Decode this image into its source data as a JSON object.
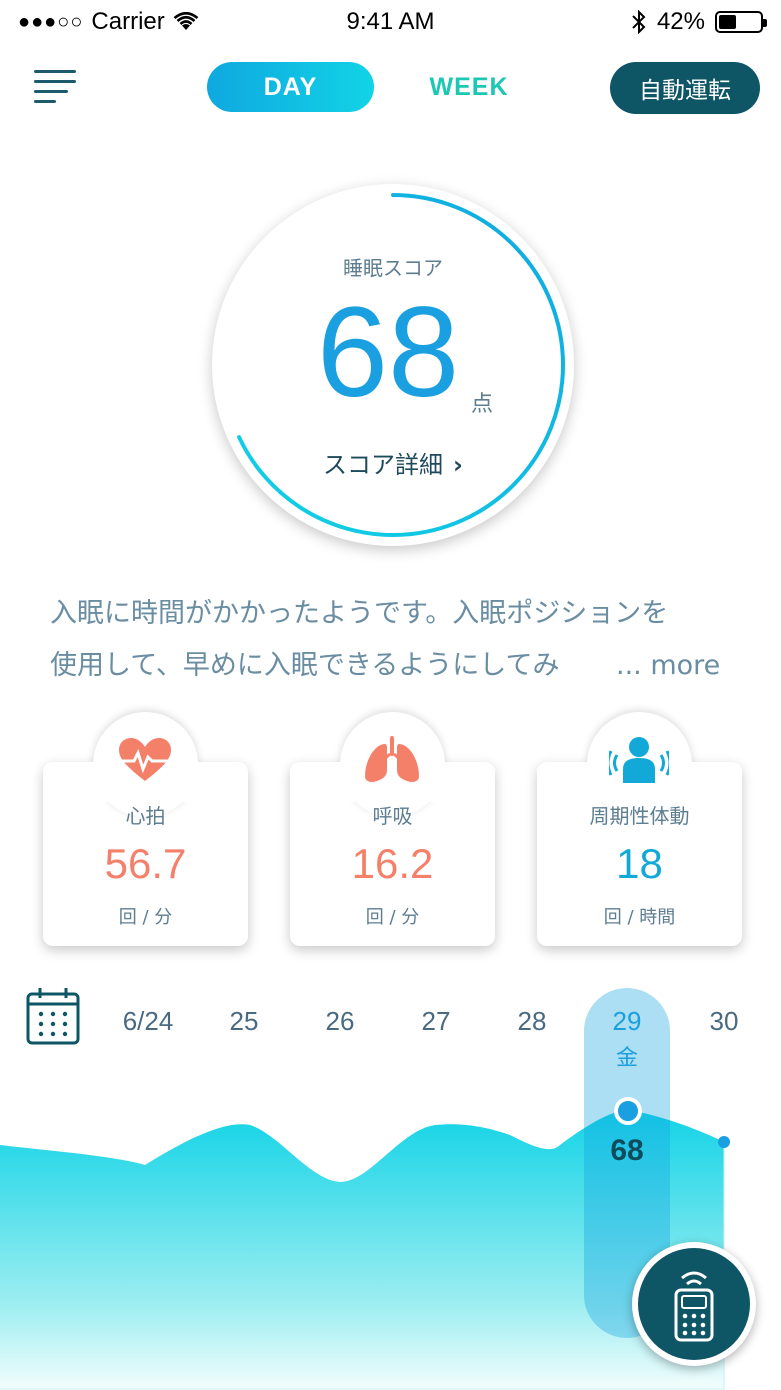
{
  "status_bar": {
    "carrier": "Carrier",
    "time": "9:41 AM",
    "battery": "42%",
    "battery_level": 0.42
  },
  "header": {
    "tab_day": "DAY",
    "tab_week": "WEEK",
    "auto_button": "自動運転"
  },
  "score": {
    "label": "睡眠スコア",
    "value": "68",
    "unit": "点",
    "detail_link": "スコア詳細",
    "progress": 0.68
  },
  "advice": {
    "line1": "入眠に時間がかかったようです。入眠ポジションを",
    "line2": "使用して、早めに入眠できるようにしてみ",
    "more": "... more"
  },
  "metrics": [
    {
      "label": "心拍",
      "value": "56.7",
      "unit": "回 / 分",
      "color": "#f5806a",
      "icon": "heart-pulse-icon"
    },
    {
      "label": "呼吸",
      "value": "16.2",
      "unit": "回 / 分",
      "color": "#f5806a",
      "icon": "lungs-icon"
    },
    {
      "label": "周期性体動",
      "value": "18",
      "unit": "回 / 時間",
      "color": "#12a9d8",
      "icon": "person-movement-icon"
    }
  ],
  "dates": [
    "6/24",
    "25",
    "26",
    "27",
    "28",
    "29",
    "30"
  ],
  "selected_date": {
    "date": "29",
    "weekday": "金",
    "score": "68"
  },
  "colors": {
    "accent": "#1a9fe0",
    "dark_teal": "#0e5566",
    "week_green": "#1cc7b3",
    "metric_red": "#f5806a"
  }
}
